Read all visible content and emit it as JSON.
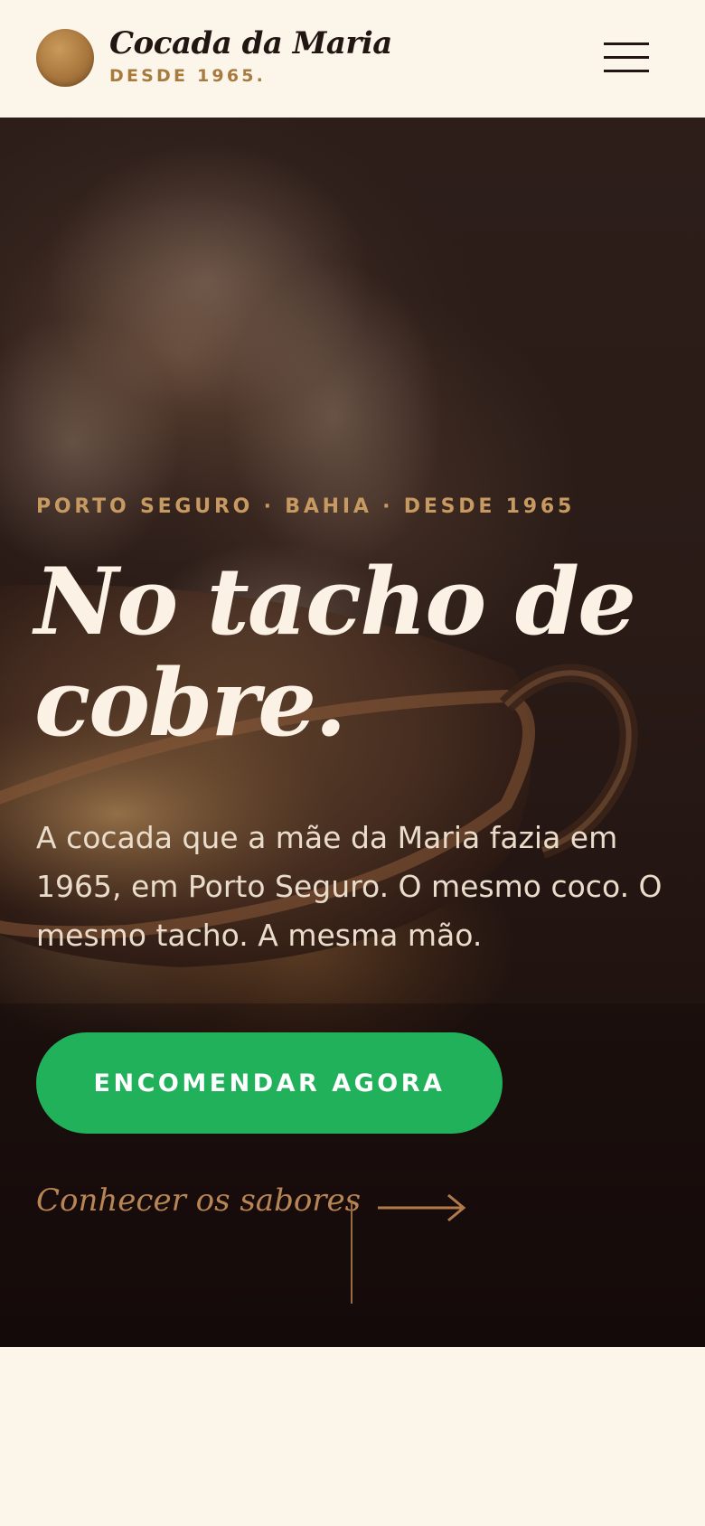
{
  "header": {
    "brand_name": "Cocada da Maria",
    "brand_tagline": "DESDE 1965.",
    "logo_icon": "coconut-logo-icon",
    "menu_icon": "hamburger-menu-icon"
  },
  "hero": {
    "kicker": "PORTO SEGURO · BAHIA · DESDE 1965",
    "headline_line1": "No tacho de",
    "headline_line2": "cobre.",
    "lead": "A cocada que a mãe da Maria fazia em 1965, em Porto Seguro. O mesmo coco. O mesmo tacho. A mesma mão.",
    "cta_label": "ENCOMENDAR AGORA",
    "secondary_link": "Conhecer os sabores",
    "arrow_icon": "arrow-right-icon",
    "background_image": "copper-pan-steam-photo"
  },
  "colors": {
    "accent_green": "#21b15a",
    "gold": "#c79a62",
    "cream": "#fcf5ea",
    "dark": "#221612"
  }
}
